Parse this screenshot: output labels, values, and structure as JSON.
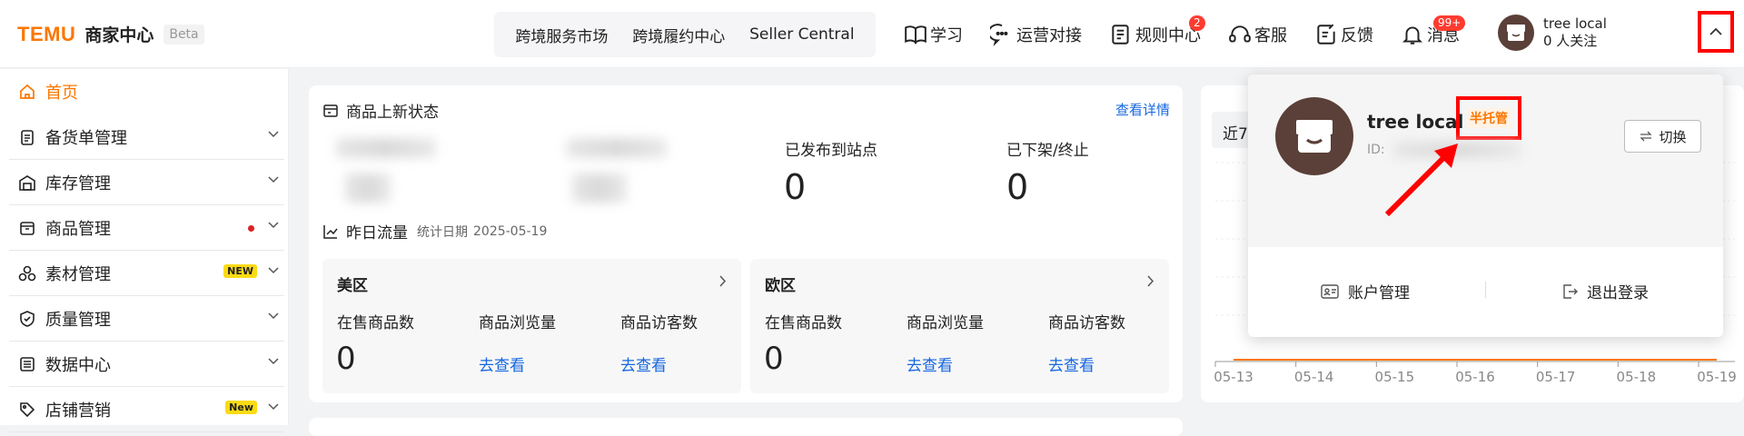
{
  "header": {
    "brand": "TEMU",
    "title": "商家中心",
    "beta": "Beta",
    "services": [
      "跨境服务市场",
      "跨境履约中心",
      "Seller Central"
    ],
    "nav": [
      {
        "label": "学习",
        "icon": "book-icon"
      },
      {
        "label": "运营对接",
        "icon": "chat-icon"
      },
      {
        "label": "规则中心",
        "icon": "document-icon",
        "badge": "2"
      },
      {
        "label": "客服",
        "icon": "headset-icon"
      },
      {
        "label": "反馈",
        "icon": "feedback-icon"
      },
      {
        "label": "消息",
        "icon": "bell-icon",
        "badge": "99+"
      }
    ],
    "user": {
      "name": "tree local",
      "follow": "0 人关注"
    }
  },
  "sidebar": {
    "items": [
      {
        "label": "首页",
        "icon": "home-icon"
      },
      {
        "label": "备货单管理",
        "icon": "clipboard-icon"
      },
      {
        "label": "库存管理",
        "icon": "warehouse-icon"
      },
      {
        "label": "商品管理",
        "icon": "product-icon"
      },
      {
        "label": "素材管理",
        "icon": "material-icon",
        "badge": "NEW"
      },
      {
        "label": "质量管理",
        "icon": "shield-icon"
      },
      {
        "label": "数据中心",
        "icon": "data-icon"
      },
      {
        "label": "店铺营销",
        "icon": "tag-icon",
        "badge": "New"
      }
    ]
  },
  "product_status": {
    "title": "商品上新状态",
    "detail_link": "查看详情",
    "published_label": "已发布到站点",
    "published_value": "0",
    "delisted_label": "已下架/终止",
    "delisted_value": "0"
  },
  "traffic": {
    "title": "昨日流量",
    "date_label": "统计日期",
    "date": "2025-05-19",
    "regions": [
      {
        "name": "美区",
        "on_sale_label": "在售商品数",
        "on_sale_value": "0",
        "views_label": "商品浏览量",
        "views_link": "去查看",
        "visitors_label": "商品访客数",
        "visitors_link": "去查看"
      },
      {
        "name": "欧区",
        "on_sale_label": "在售商品数",
        "on_sale_value": "0",
        "views_label": "商品浏览量",
        "views_link": "去查看",
        "visitors_label": "商品访客数",
        "visitors_link": "去查看"
      }
    ]
  },
  "right_card": {
    "tab_partial": "近7"
  },
  "chart_data": {
    "type": "line",
    "categories": [
      "05-13",
      "05-14",
      "05-15",
      "05-16",
      "05-17",
      "05-18",
      "05-19"
    ],
    "series": [
      {
        "values": [
          0,
          0,
          0,
          0,
          0,
          0,
          0
        ]
      }
    ]
  },
  "popup": {
    "user_name": "tree local",
    "tag": "半托管",
    "id_label": "ID:",
    "switch_label": "切换",
    "account_label": "账户管理",
    "logout_label": "退出登录"
  },
  "colors": {
    "accent": "#fb7701",
    "link": "#1667e0",
    "annotation": "#ff0000",
    "badge": "#ff3b30"
  }
}
